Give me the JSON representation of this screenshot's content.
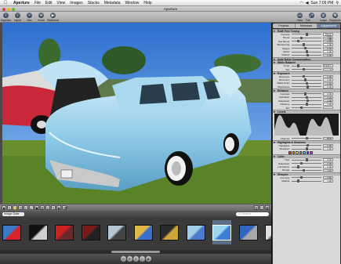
{
  "menubar": {
    "app": "Aperture",
    "items": [
      "File",
      "Edit",
      "View",
      "Images",
      "Stacks",
      "Metadata",
      "Window",
      "Help"
    ],
    "clock": "Sun 7:09 PM"
  },
  "window": {
    "title": "Aperture"
  },
  "toolbar": {
    "left": [
      {
        "label": "Inspector",
        "icon": "i"
      },
      {
        "label": "Import",
        "icon": "↓"
      },
      {
        "label": "New",
        "icon": "+"
      },
      {
        "label": "Email",
        "icon": "✉"
      },
      {
        "label": "Slideshow",
        "icon": "▶"
      }
    ],
    "right": [
      {
        "label": "View",
        "icon": "▭"
      },
      {
        "label": "Full Screen",
        "icon": "⤢"
      },
      {
        "label": "Loupe",
        "icon": "◎"
      },
      {
        "label": "Keywords",
        "icon": "⌘"
      }
    ]
  },
  "viewer_tools": {
    "left": [
      "◆",
      "↖",
      "✋",
      "⟲",
      "✂",
      "◐",
      "▣",
      "▥",
      "⊘",
      "✎",
      "◉",
      "⌫"
    ],
    "right": [
      "▥",
      "◫",
      "▦"
    ]
  },
  "browser": {
    "filter": "Image Date",
    "search_placeholder": "Q Search"
  },
  "filmstrip": {
    "count": 14,
    "selected_index": 8
  },
  "inspector": {
    "tabs": [
      "Projects",
      "Metadata",
      "Adjustments"
    ],
    "sections": [
      {
        "title": "RAW Fine Tuning",
        "rows": [
          {
            "label": "Camera:",
            "value": "Canon EOS 5D"
          },
          {
            "label": "Boost:",
            "value": "1.00"
          },
          {
            "label": "Hue Boost:",
            "value": "0.00"
          },
          {
            "label": "Sharpening:",
            "value": "0.00"
          },
          {
            "label": "Edges:",
            "value": "0.00"
          },
          {
            "label": "Moiré:",
            "value": "0.00"
          },
          {
            "label": "Radius:",
            "value": "0.00"
          }
        ]
      },
      {
        "title": "Auto Noise Compensation",
        "rows": []
      },
      {
        "title": "White Balance",
        "rows": [
          {
            "label": "Temp:",
            "value": "5,928 K"
          },
          {
            "label": "Tint:",
            "value": "0"
          }
        ]
      },
      {
        "title": "Exposure",
        "rows": [
          {
            "label": "Exposure:",
            "value": "0.00"
          },
          {
            "label": "Recovery:",
            "value": "0.00"
          },
          {
            "label": "Black Point:",
            "value": "0.00"
          },
          {
            "label": "Brightness:",
            "value": "0.00"
          }
        ]
      },
      {
        "title": "Enhance",
        "rows": [
          {
            "label": "Contrast:",
            "value": "0.00"
          },
          {
            "label": "Definition:",
            "value": "0.00"
          },
          {
            "label": "Saturation:",
            "value": "1.00"
          },
          {
            "label": "Vibrancy:",
            "value": "0.00"
          },
          {
            "label": "Tint:",
            "value": ""
          }
        ]
      },
      {
        "title": "Levels",
        "rows": [
          {
            "label": "Channel:",
            "value": "RGB"
          }
        ]
      },
      {
        "title": "Highlights & Shadows",
        "rows": [
          {
            "label": "Highlights:",
            "value": "0.00"
          },
          {
            "label": "Shadows:",
            "value": "0.00"
          }
        ]
      },
      {
        "title": "Color",
        "rows": [
          {
            "label": "Hue:",
            "value": "0.00"
          },
          {
            "label": "Saturation:",
            "value": "0.00"
          },
          {
            "label": "Luminance:",
            "value": "0.00"
          },
          {
            "label": "Range:",
            "value": "1.00"
          }
        ]
      },
      {
        "title": "Sharpen",
        "rows": [
          {
            "label": "Intensity:",
            "value": "0.50"
          },
          {
            "label": "Radius:",
            "value": "1.00"
          }
        ]
      }
    ]
  },
  "colors": {
    "accent": "#6b7f9a",
    "sky": "#3e7fd6",
    "car": "#9ed4ee"
  }
}
